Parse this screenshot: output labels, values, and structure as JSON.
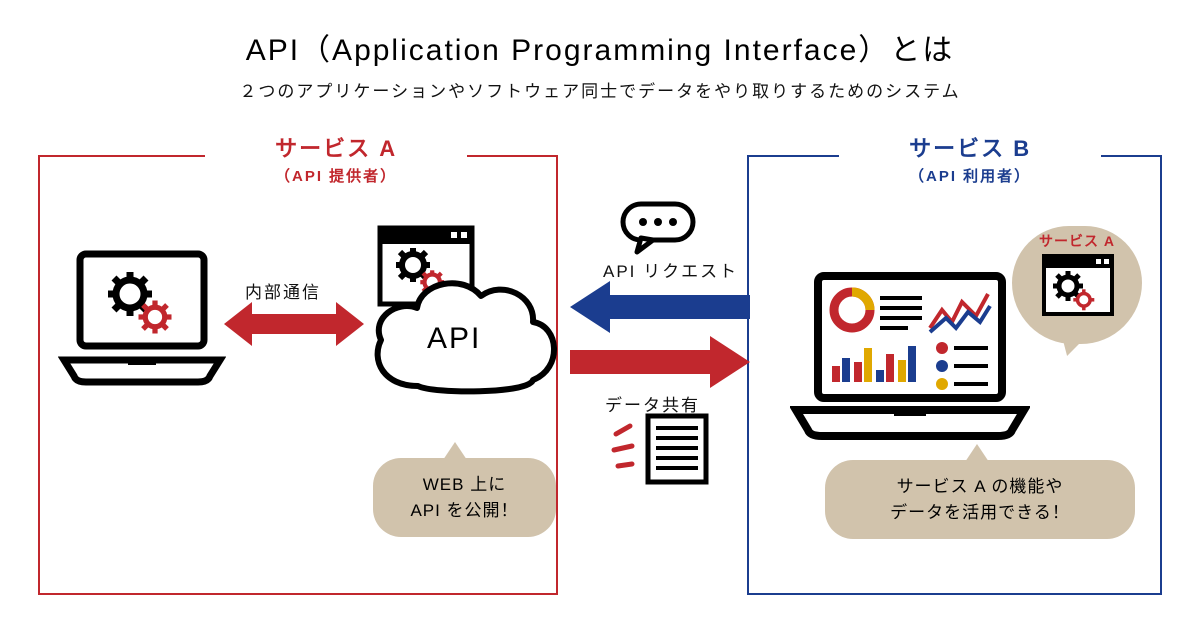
{
  "title": "API（Application Programming Interface）とは",
  "subtitle": "２つのアプリケーションやソフトウェア同士でデータをやり取りするためのシステム",
  "service_a": {
    "name": "サービス A",
    "role": "（API 提供者）"
  },
  "service_b": {
    "name": "サービス B",
    "role": "（API 利用者）"
  },
  "labels": {
    "internal": "内部通信",
    "request": "API リクエスト",
    "share": "データ共有",
    "api": "API"
  },
  "bubble_api_line1": "WEB 上に",
  "bubble_api_line2": "API を公開！",
  "bubble_usage_line1": "サービス A の機能や",
  "bubble_usage_line2": "データを活用できる！",
  "mini_label": "サービス A",
  "colors": {
    "red": "#c1272d",
    "blue": "#1b3d8f",
    "tan": "#d1c3ac"
  }
}
